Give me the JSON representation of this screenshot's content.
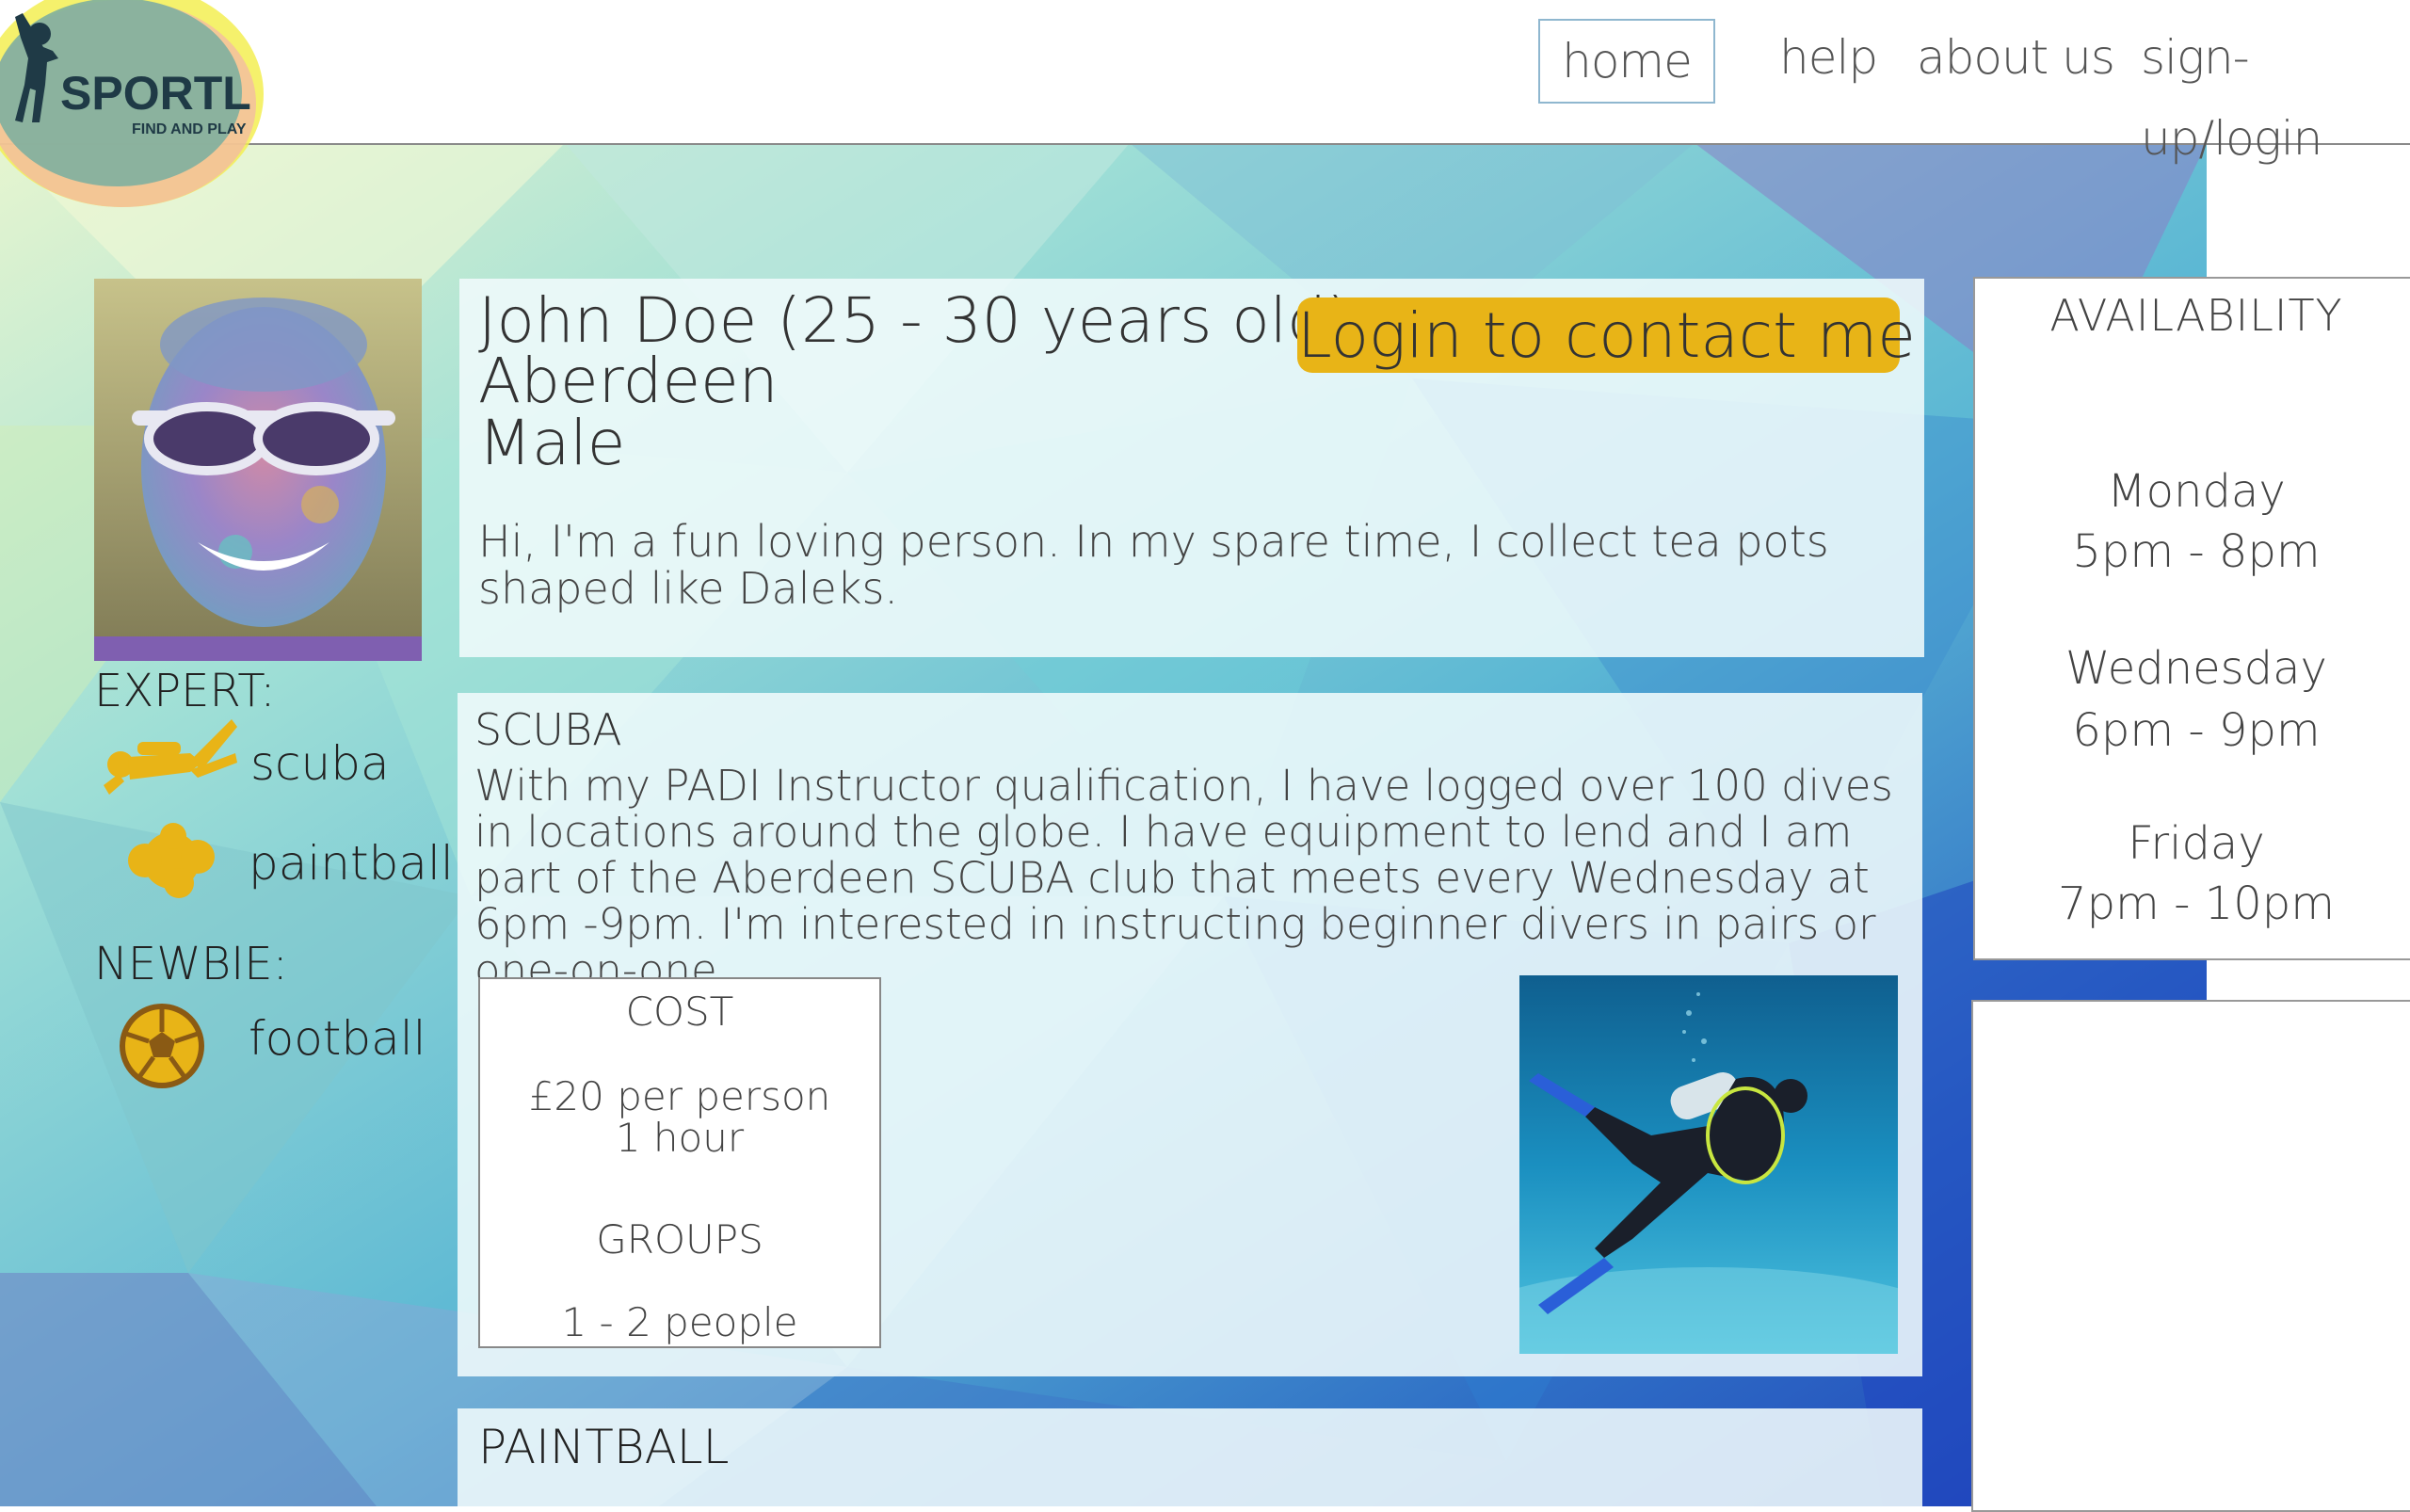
{
  "brand": {
    "name": "SPORTL",
    "tagline": "FIND AND PLAY"
  },
  "nav": {
    "home": "home",
    "help": "help",
    "about": "about us",
    "sign": "sign-up/login"
  },
  "profile": {
    "name_age": "John Doe (25 - 30 years old)",
    "city": "Aberdeen",
    "gender": "Male",
    "contact_button": "Login to contact me",
    "bio": "Hi, I'm a fun loving person. In my spare time, I collect tea pots shaped like Daleks."
  },
  "skills": {
    "expert_heading": "EXPERT:",
    "expert": [
      {
        "label": "scuba",
        "icon": "scuba-diver-icon"
      },
      {
        "label": "paintball",
        "icon": "paint-splat-icon"
      }
    ],
    "newbie_heading": "NEWBIE:",
    "newbie": [
      {
        "label": "football",
        "icon": "football-icon"
      }
    ]
  },
  "scuba": {
    "title": "SCUBA",
    "description": "With my PADI Instructor qualification, I have logged over 100 dives in locations around the globe. I have  equipment to lend and I am part of the Aberdeen SCUBA club that meets every Wednesday at  6pm -9pm. I'm interested in instructing beginner divers in pairs or one-on-one.",
    "cost_heading": "COST",
    "cost_price": "£20 per person",
    "cost_duration": "1 hour",
    "groups_heading": "GROUPS",
    "groups_size": "1 - 2 people"
  },
  "paintball": {
    "title": "PAINTBALL"
  },
  "availability": {
    "title": "AVAILABILITY",
    "slots": [
      {
        "day": "Monday",
        "time": "5pm - 8pm"
      },
      {
        "day": "Wednesday",
        "time": "6pm - 9pm"
      },
      {
        "day": "Friday",
        "time": "7pm - 10pm"
      }
    ]
  },
  "colors": {
    "accent_yellow": "#e8b417",
    "icon_brown": "#8a5a14",
    "nav_border": "#8fb7cf"
  }
}
